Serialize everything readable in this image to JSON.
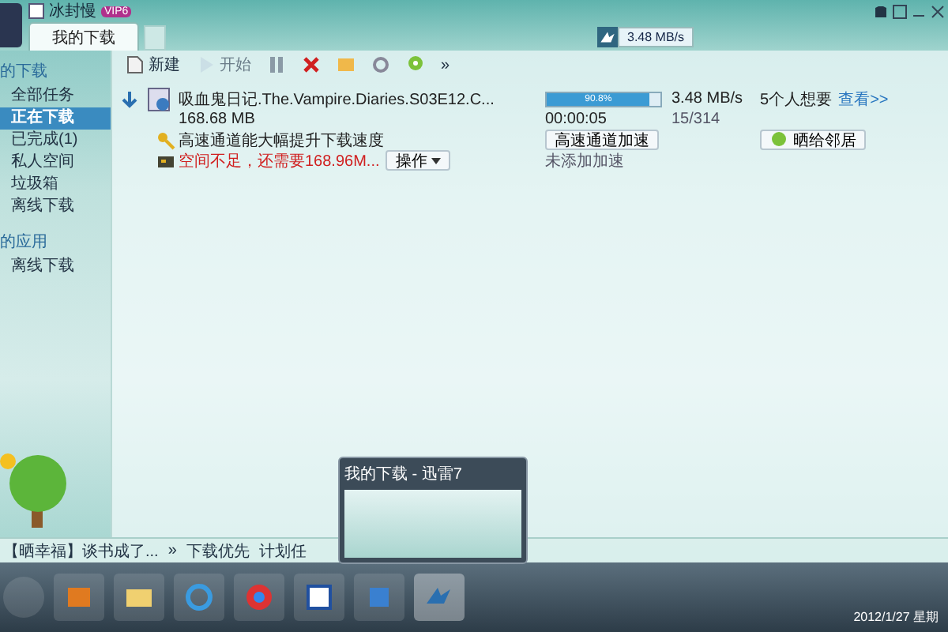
{
  "header": {
    "username": "冰封慢",
    "vip_badge": "VIP6",
    "tab": {
      "label": "我的下载",
      "selected": true
    },
    "speed": "3.48 MB/s"
  },
  "sidebar": {
    "sections": [
      {
        "title": "的下载",
        "items": [
          {
            "label": "全部任务",
            "selected": false
          },
          {
            "label": "正在下载",
            "selected": true
          },
          {
            "label": "已完成(1)",
            "selected": false
          },
          {
            "label": "私人空间",
            "selected": false
          },
          {
            "label": "垃圾箱",
            "selected": false
          },
          {
            "label": "离线下载",
            "selected": false
          }
        ]
      },
      {
        "title": "的应用",
        "items": [
          {
            "label": "离线下载",
            "selected": false
          }
        ]
      }
    ]
  },
  "toolbar": [
    {
      "kind": "new",
      "label": "新建",
      "disabled": false
    },
    {
      "kind": "start",
      "label": "开始",
      "disabled": true
    },
    {
      "kind": "pause",
      "disabled": false
    },
    {
      "kind": "delete",
      "disabled": false
    },
    {
      "kind": "folder",
      "disabled": false
    },
    {
      "kind": "settings",
      "disabled": false
    },
    {
      "kind": "pin",
      "disabled": false
    },
    {
      "kind": "more",
      "label": "»",
      "disabled": false
    }
  ],
  "download": {
    "filename": "吸血鬼日记.The.Vampire.Diaries.S03E12.C...",
    "size": "168.68 MB",
    "level": 0.908,
    "percent": "90.8%",
    "remaining": "00:00:05",
    "speed": "3.48 MB/s",
    "peers": "15/314",
    "wanted": "5个人想要",
    "view_link": "查看>>",
    "tip": "高速通道能大幅提升下载速度",
    "boost_button": "高速通道加速",
    "share_button": "晒给邻居",
    "warning": "空间不足，还需要168.96M...",
    "action_button": "操作",
    "accel_status": "未添加加速"
  },
  "status_bar": {
    "news": "【晒幸福】谈书成了...",
    "more": "»",
    "items": [
      "下载优先",
      "计划任"
    ]
  },
  "thumbnail": {
    "title": "我的下载 - 迅雷7"
  },
  "taskbar": {
    "date": "2012/1/27 星期"
  }
}
